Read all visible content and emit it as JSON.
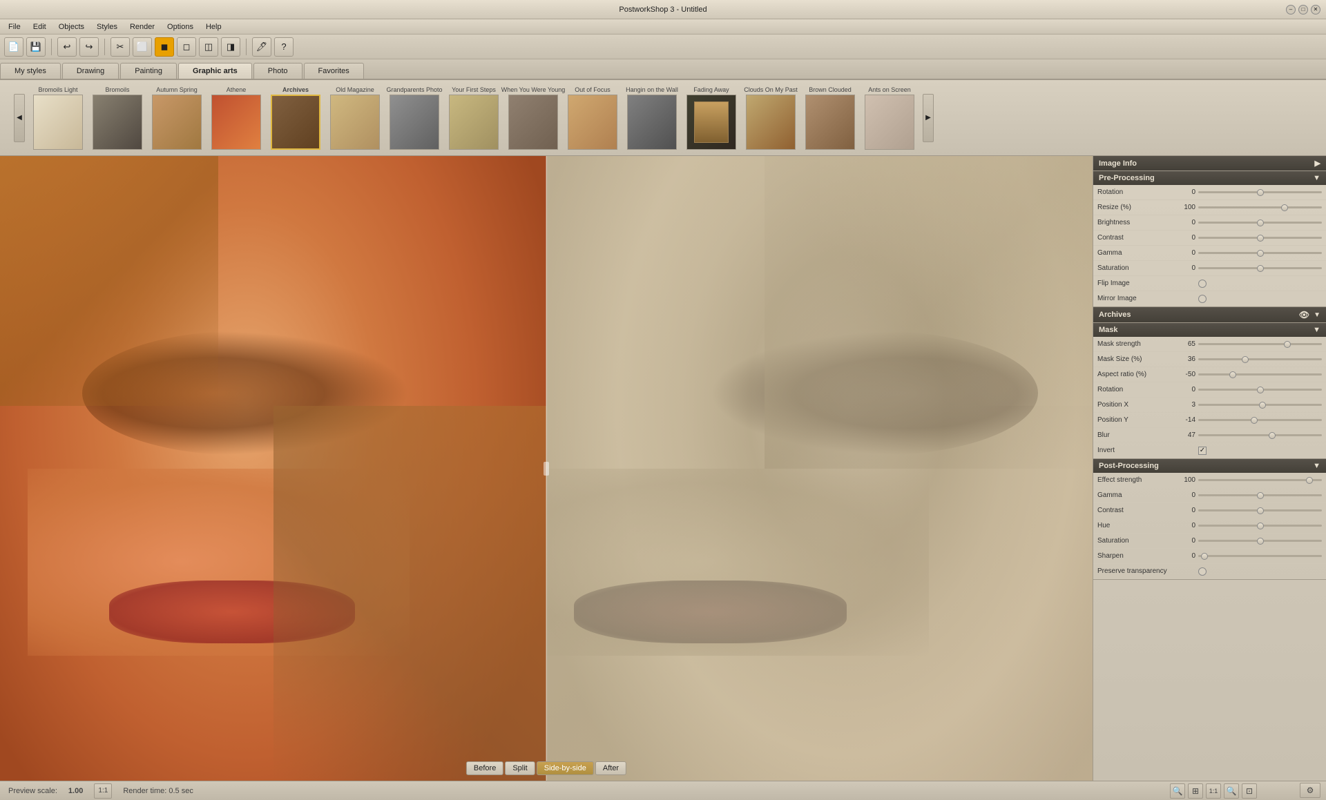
{
  "app": {
    "title": "PostworkShop 3 - Untitled"
  },
  "menu": {
    "items": [
      "File",
      "Edit",
      "Objects",
      "Styles",
      "Render",
      "Options",
      "Help"
    ]
  },
  "toolbar": {
    "buttons": [
      "📄",
      "💾",
      "↩",
      "↪",
      "✂",
      "📋",
      "⬜",
      "◻",
      "◼",
      "◽",
      "◾",
      "🖊",
      "?"
    ]
  },
  "style_tabs": {
    "tabs": [
      "My styles",
      "Drawing",
      "Painting",
      "Graphic arts",
      "Photo",
      "Favorites"
    ]
  },
  "thumbnails": {
    "items": [
      {
        "label": "Bromoils Light",
        "class": "thumb-bromoils-light",
        "active": false
      },
      {
        "label": "Bromoils",
        "class": "thumb-bromoils",
        "active": false
      },
      {
        "label": "Autumn Spring",
        "class": "thumb-autumn",
        "active": false
      },
      {
        "label": "Athene",
        "class": "thumb-athene",
        "active": false
      },
      {
        "label": "Archives",
        "class": "thumb-archives",
        "active": true
      },
      {
        "label": "Old Magazine",
        "class": "thumb-old-magazine",
        "active": false
      },
      {
        "label": "Grandparents Photo",
        "class": "thumb-grandparents",
        "active": false
      },
      {
        "label": "Your First Steps",
        "class": "thumb-first-steps",
        "active": false
      },
      {
        "label": "When You Were Young",
        "class": "thumb-young",
        "active": false
      },
      {
        "label": "Out of Focus",
        "class": "thumb-out-focus",
        "active": false
      },
      {
        "label": "Hangin on the Wall",
        "class": "thumb-hangin",
        "active": false
      },
      {
        "label": "Fading Away",
        "class": "thumb-fading",
        "active": false
      },
      {
        "label": "Clouds On My Past",
        "class": "thumb-clouds",
        "active": false
      },
      {
        "label": "Brown Clouded",
        "class": "thumb-brown",
        "active": false
      },
      {
        "label": "Ants on Screen",
        "class": "thumb-ants",
        "active": false
      }
    ]
  },
  "view_controls": {
    "buttons": [
      "Before",
      "Split",
      "Side-by-side",
      "After"
    ],
    "active": "Split"
  },
  "image_info": {
    "header": "Image Info",
    "arrow": "▶"
  },
  "pre_processing": {
    "header": "Pre-Processing",
    "arrow": "▼",
    "params": [
      {
        "label": "Rotation",
        "value": "0",
        "thumb_pct": 50
      },
      {
        "label": "Resize (%)",
        "value": "100",
        "thumb_pct": 70
      },
      {
        "label": "Brightness",
        "value": "0",
        "thumb_pct": 50
      },
      {
        "label": "Contrast",
        "value": "0",
        "thumb_pct": 50
      },
      {
        "label": "Gamma",
        "value": "0",
        "thumb_pct": 50
      },
      {
        "label": "Saturation",
        "value": "0",
        "thumb_pct": 50
      }
    ],
    "checkboxes": [
      {
        "label": "Flip Image",
        "checked": false
      },
      {
        "label": "Mirror Image",
        "checked": false
      }
    ]
  },
  "archives": {
    "header": "Archives",
    "arrow": "▼"
  },
  "mask": {
    "header": "Mask",
    "arrow": "▼",
    "params": [
      {
        "label": "Mask strength",
        "value": "65",
        "thumb_pct": 72
      },
      {
        "label": "Mask Size (%)",
        "value": "36",
        "thumb_pct": 38
      },
      {
        "label": "Aspect ratio (%)",
        "value": "-50",
        "thumb_pct": 28
      },
      {
        "label": "Rotation",
        "value": "0",
        "thumb_pct": 50
      },
      {
        "label": "Position X",
        "value": "3",
        "thumb_pct": 52
      },
      {
        "label": "Position Y",
        "value": "-14",
        "thumb_pct": 45
      },
      {
        "label": "Blur",
        "value": "47",
        "thumb_pct": 60
      }
    ],
    "checkboxes": [
      {
        "label": "Invert",
        "checked": true,
        "type": "square"
      }
    ]
  },
  "post_processing": {
    "header": "Post-Processing",
    "arrow": "▼",
    "params": [
      {
        "label": "Effect strength",
        "value": "100",
        "thumb_pct": 90
      },
      {
        "label": "Gamma",
        "value": "0",
        "thumb_pct": 50
      },
      {
        "label": "Contrast",
        "value": "0",
        "thumb_pct": 50
      },
      {
        "label": "Hue",
        "value": "0",
        "thumb_pct": 50
      },
      {
        "label": "Saturation",
        "value": "0",
        "thumb_pct": 50
      },
      {
        "label": "Sharpen",
        "value": "0",
        "thumb_pct": 5
      }
    ],
    "checkboxes": [
      {
        "label": "Preserve transparency",
        "checked": false
      }
    ]
  },
  "status_bar": {
    "preview_label": "Preview scale:",
    "preview_value": "1.00",
    "ratio_label": "1:1",
    "render_label": "Render time: 0.5 sec"
  }
}
